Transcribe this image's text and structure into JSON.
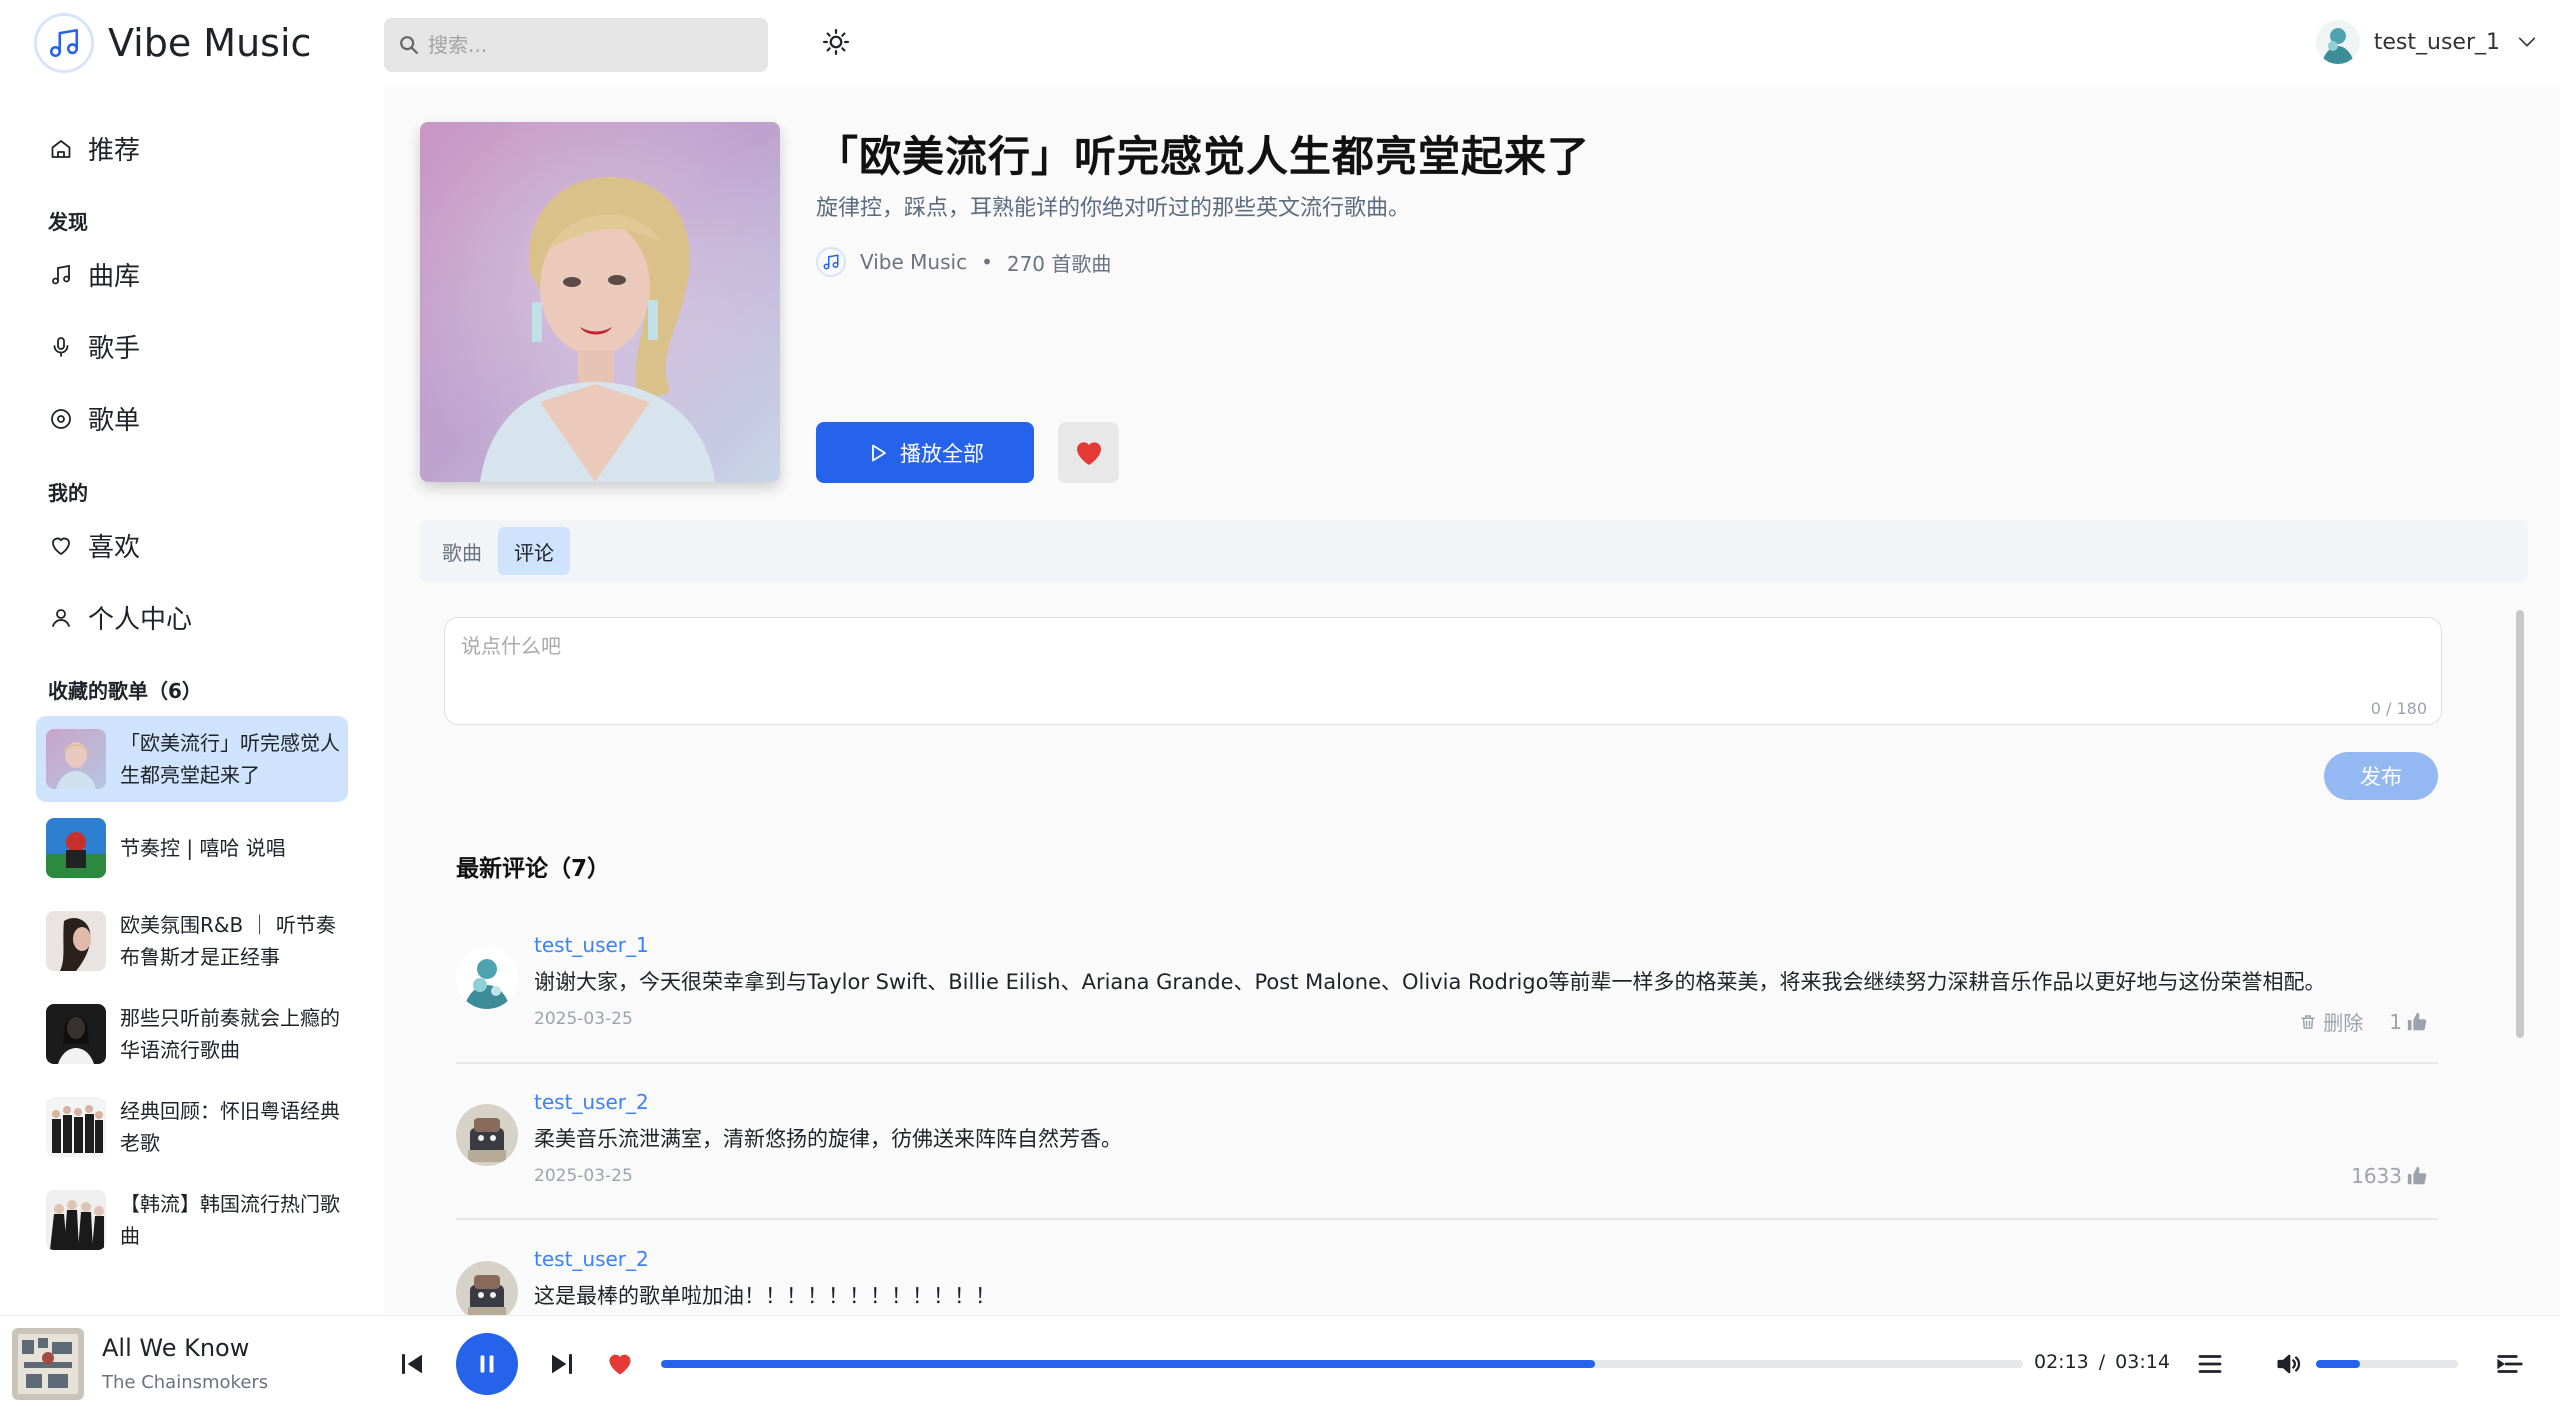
{
  "app": {
    "name": "Vibe Music"
  },
  "header": {
    "search_placeholder": "搜索...",
    "username": "test_user_1"
  },
  "sidebar": {
    "home": "推荐",
    "section_discover": "发现",
    "discover_items": [
      "曲库",
      "歌手",
      "歌单"
    ],
    "section_mine": "我的",
    "mine_items": [
      "喜欢",
      "个人中心"
    ],
    "section_collected": "收藏的歌单（6）",
    "collected": [
      {
        "title": "「欧美流行」听完感觉人生都亮堂起来了",
        "active": true
      },
      {
        "title": "节奏控 | 嘻哈 说唱",
        "active": false
      },
      {
        "title": "欧美氛围R&B ｜ 听节奏布鲁斯才是正经事",
        "active": false
      },
      {
        "title": "那些只听前奏就会上瘾的华语流行歌曲",
        "active": false
      },
      {
        "title": "经典回顾：怀旧粤语经典老歌",
        "active": false
      },
      {
        "title": "【韩流】韩国流行热门歌曲",
        "active": false
      }
    ]
  },
  "playlist": {
    "title": "「欧美流行」听完感觉人生都亮堂起来了",
    "description": "旋律控，踩点，耳熟能详的你绝对听过的那些英文流行歌曲。",
    "creator": "Vibe Music",
    "meta_dot": "•",
    "song_count": "270 首歌曲",
    "play_all": "播放全部",
    "favorited": true
  },
  "tabs": [
    {
      "label": "歌曲",
      "active": false
    },
    {
      "label": "评论",
      "active": true
    }
  ],
  "comment_input": {
    "placeholder": "说点什么吧",
    "value": "",
    "counter": "0 / 180",
    "publish": "发布"
  },
  "comments_section": {
    "title": "最新评论（7）",
    "items": [
      {
        "user": "test_user_1",
        "text": "谢谢大家，今天很荣幸拿到与Taylor Swift、Billie Eilish、Ariana Grande、Post Malone、Olivia Rodrigo等前辈一样多的格莱美，将来我会继续努力深耕音乐作品以更好地与这份荣誉相配。",
        "date": "2025-03-25",
        "delete_label": "删除",
        "likes": "1",
        "can_delete": true
      },
      {
        "user": "test_user_2",
        "text": "柔美音乐流泄满室，清新悠扬的旋律，彷佛送来阵阵自然芳香。",
        "date": "2025-03-25",
        "delete_label": "",
        "likes": "1633",
        "can_delete": false
      },
      {
        "user": "test_user_2",
        "text": "这是最棒的歌单啦加油！！！！！！！！！！！！",
        "date": "",
        "delete_label": "",
        "likes": "",
        "can_delete": false
      }
    ]
  },
  "player": {
    "title": "All We Know",
    "artist": "The Chainsmokers",
    "current_time": "02:13",
    "time_sep": "/",
    "total_time": "03:14",
    "progress_fraction": 0.686,
    "volume_fraction": 0.31,
    "liked": true
  },
  "colors": {
    "accent": "#2563eb",
    "active_bg": "#cfe3fc",
    "heart": "#e53935",
    "username_link": "#3b82f6"
  }
}
